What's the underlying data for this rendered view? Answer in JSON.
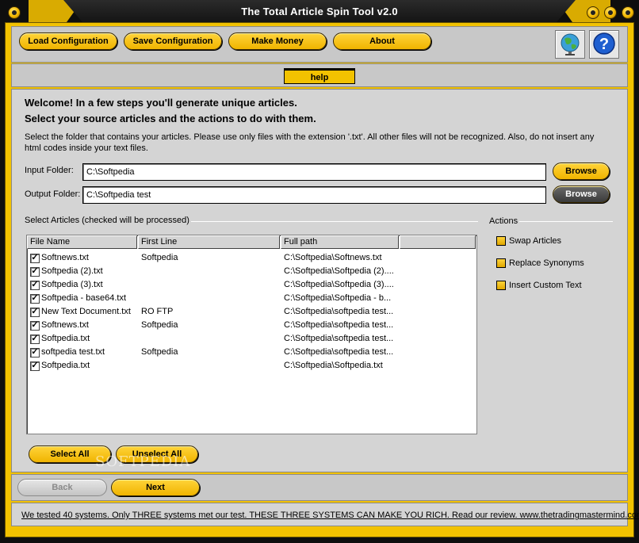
{
  "window": {
    "title": "The Total Article Spin Tool v2.0",
    "accent_color": "#f2c200"
  },
  "toolbar": {
    "load_label": "Load Configuration",
    "save_label": "Save Configuration",
    "money_label": "Make Money",
    "about_label": "About",
    "globe_icon": "globe-icon",
    "help_icon": "question-icon"
  },
  "help_tab": {
    "label": "help"
  },
  "main": {
    "welcome_line1": "Welcome! In a few steps you'll generate unique articles.",
    "welcome_line2": "Select your source articles and the actions to do with them.",
    "description": "Select the folder that contains your articles. Please use only files with the extension '.txt'. All other files will not be recognized. Also, do not insert any html codes inside your text files.",
    "input_folder_label": "Input Folder:",
    "input_folder_value": "C:\\Softpedia",
    "output_folder_label": "Output Folder:",
    "output_folder_value": "C:\\Softpedia test",
    "browse_label": "Browse"
  },
  "articles": {
    "group_label": "Select Articles (checked will be processed)",
    "columns": [
      "File Name",
      "First Line",
      "Full path"
    ],
    "rows": [
      {
        "checked": "✓",
        "name": "Softnews.txt",
        "first": "Softpedia",
        "path": "C:\\Softpedia\\Softnews.txt"
      },
      {
        "checked": "✓",
        "name": "Softpedia (2).txt",
        "first": "",
        "path": "C:\\Softpedia\\Softpedia (2)...."
      },
      {
        "checked": "✓",
        "name": "Softpedia (3).txt",
        "first": "",
        "path": "C:\\Softpedia\\Softpedia (3)...."
      },
      {
        "checked": "✓",
        "name": "Softpedia - base64.txt",
        "first": "",
        "path": "C:\\Softpedia\\Softpedia - b..."
      },
      {
        "checked": "✓",
        "name": "New Text Document.txt",
        "first": "RO FTP",
        "path": "C:\\Softpedia\\softpedia test..."
      },
      {
        "checked": "✓",
        "name": "Softnews.txt",
        "first": "Softpedia",
        "path": "C:\\Softpedia\\softpedia test..."
      },
      {
        "checked": "✓",
        "name": "Softpedia.txt",
        "first": "",
        "path": "C:\\Softpedia\\softpedia test..."
      },
      {
        "checked": "✓",
        "name": "softpedia test.txt",
        "first": "Softpedia",
        "path": "C:\\Softpedia\\softpedia test..."
      },
      {
        "checked": "✓",
        "name": "Softpedia.txt",
        "first": "",
        "path": "C:\\Softpedia\\Softpedia.txt"
      }
    ],
    "select_all_label": "Select All",
    "unselect_all_label": "Unselect All"
  },
  "actions": {
    "group_label": "Actions",
    "items": [
      "Swap Articles",
      "Replace Synonyms",
      "Insert Custom Text"
    ]
  },
  "nav": {
    "back_label": "Back",
    "next_label": "Next"
  },
  "ad": {
    "text": "We tested 40 systems. Only THREE systems met our test. THESE THREE SYSTEMS CAN MAKE YOU RICH. Read our review. www.thetradingmastermind.com"
  },
  "watermark": {
    "text": "SOFTPEDIA"
  }
}
